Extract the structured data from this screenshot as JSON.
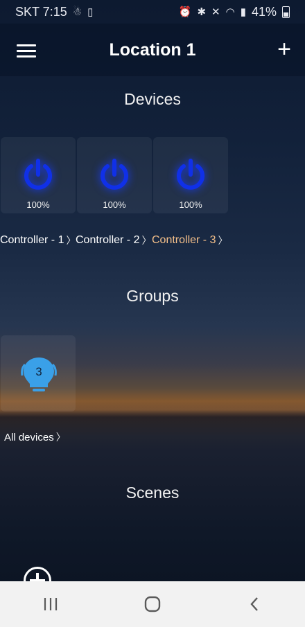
{
  "status_bar": {
    "carrier_time": "SKT 7:15",
    "battery_pct": "41%"
  },
  "app_bar": {
    "title": "Location 1"
  },
  "devices": {
    "title": "Devices",
    "items": [
      {
        "pct": "100%",
        "label": "Controller - 1",
        "active": false
      },
      {
        "pct": "100%",
        "label": "Controller - 2",
        "active": false
      },
      {
        "pct": "100%",
        "label": "Controller - 3",
        "active": true
      }
    ]
  },
  "groups": {
    "title": "Groups",
    "items": [
      {
        "count": "3",
        "label": "All devices"
      }
    ]
  },
  "scenes": {
    "title": "Scenes"
  },
  "colors": {
    "power_blue": "#1030e8",
    "bulb_blue": "#3aa0e8",
    "active_label": "#f5c08a"
  }
}
